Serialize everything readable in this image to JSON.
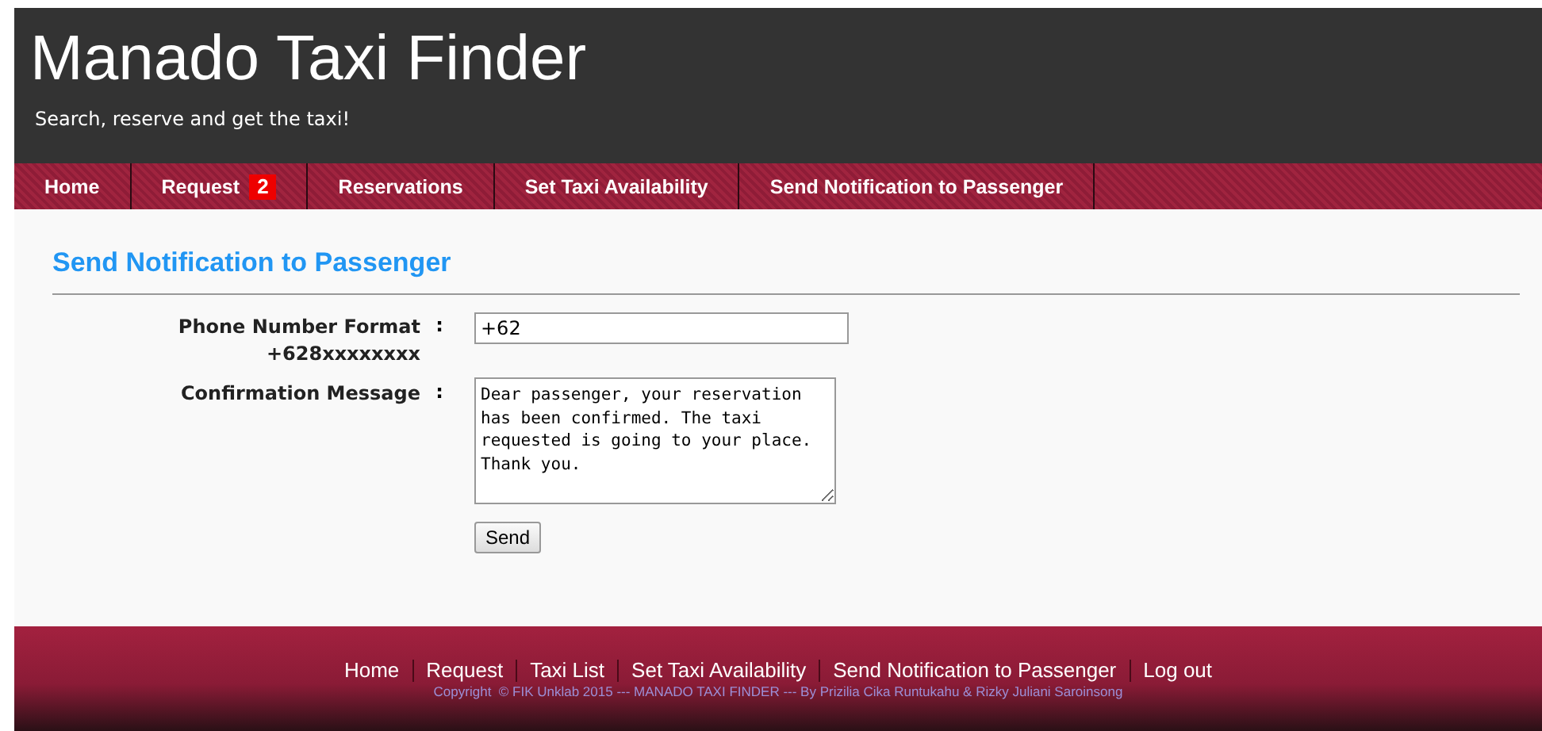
{
  "header": {
    "title": "Manado Taxi Finder",
    "tagline": "Search, reserve and get the taxi!"
  },
  "nav": [
    {
      "label": "Home"
    },
    {
      "label": "Request",
      "badge": "2"
    },
    {
      "label": "Reservations"
    },
    {
      "label": "Set Taxi Availability"
    },
    {
      "label": "Send Notification to Passenger"
    }
  ],
  "page_title": "Send Notification to Passenger",
  "form": {
    "fields": [
      {
        "kind": "input",
        "label": "Phone Number Format",
        "sublabel": "+628xxxxxxxx",
        "separator": ":",
        "value": "+62"
      },
      {
        "kind": "textarea",
        "label": "Confirmation Message",
        "separator": ":",
        "value": "Dear passenger, your reservation has been confirmed. The taxi requested is going to your place. Thank you."
      }
    ],
    "submit": "Send"
  },
  "footer": {
    "links": [
      "Home",
      "Request",
      "Taxi List",
      "Set Taxi Availability",
      "Send Notification to Passenger",
      "Log out"
    ],
    "copyright": "Copyright  © FIK Unklab 2015 --- MANADO TAXI FINDER --- By Prizilia Cika Runtukahu & Rizky Juliani Saroinsong"
  }
}
